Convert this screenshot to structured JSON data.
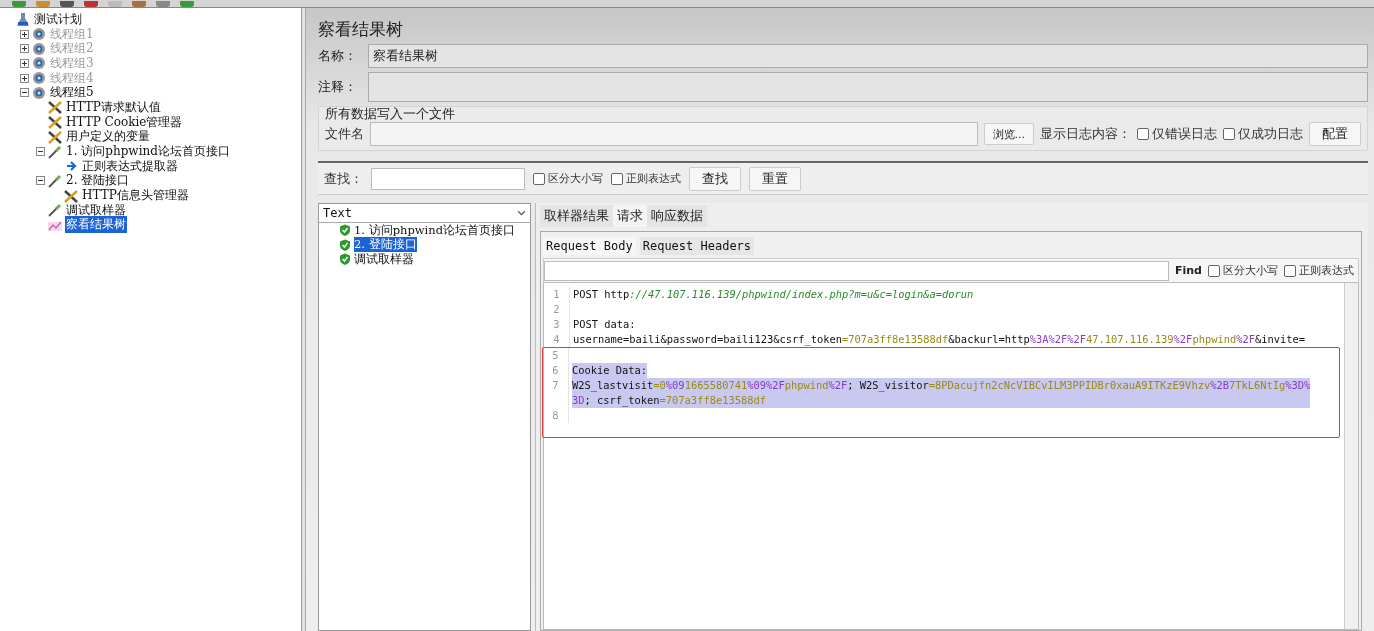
{
  "tree": [
    {
      "label": "测试计划",
      "kind": "plan",
      "selected": false,
      "disabled": false,
      "children": [
        {
          "label": "线程组1",
          "kind": "thread-group",
          "selected": false,
          "disabled": true,
          "expanded": false
        },
        {
          "label": "线程组2",
          "kind": "thread-group",
          "selected": false,
          "disabled": true,
          "expanded": false
        },
        {
          "label": "线程组3",
          "kind": "thread-group",
          "selected": false,
          "disabled": true,
          "expanded": false
        },
        {
          "label": "线程组4",
          "kind": "thread-group",
          "selected": false,
          "disabled": true,
          "expanded": false
        },
        {
          "label": "线程组5",
          "kind": "thread-group",
          "selected": false,
          "disabled": false,
          "expanded": true,
          "children": [
            {
              "label": "HTTP请求默认值",
              "kind": "config",
              "selected": false,
              "disabled": false
            },
            {
              "label": "HTTP Cookie管理器",
              "kind": "config",
              "selected": false,
              "disabled": false
            },
            {
              "label": "用户定义的变量",
              "kind": "config",
              "selected": false,
              "disabled": false
            },
            {
              "label": "1. 访问phpwind论坛首页接口",
              "kind": "sampler",
              "selected": false,
              "disabled": false,
              "expanded": true,
              "children": [
                {
                  "label": "正则表达式提取器",
                  "kind": "extractor",
                  "selected": false,
                  "disabled": false
                }
              ]
            },
            {
              "label": "2. 登陆接口",
              "kind": "sampler",
              "selected": false,
              "disabled": false,
              "expanded": true,
              "children": [
                {
                  "label": "HTTP信息头管理器",
                  "kind": "config",
                  "selected": false,
                  "disabled": false
                }
              ]
            },
            {
              "label": "调试取样器",
              "kind": "sampler",
              "selected": false,
              "disabled": false
            },
            {
              "label": "察看结果树",
              "kind": "listener",
              "selected": true,
              "disabled": false
            }
          ]
        }
      ]
    }
  ],
  "panel": {
    "title": "察看结果树",
    "name_label": "名称：",
    "name_value": "察看结果树",
    "comment_label": "注释：",
    "file_group": {
      "legend": "所有数据写入一个文件",
      "file_label": "文件名",
      "browse_button": "浏览...",
      "log_label": "显示日志内容：",
      "checkboxes": [
        {
          "label": "仅错误日志",
          "checked": false
        },
        {
          "label": "仅成功日志",
          "checked": false
        }
      ],
      "config_button": "配置"
    },
    "search": {
      "label": "查找：",
      "checkboxes": [
        {
          "label": "区分大小写",
          "checked": false
        },
        {
          "label": "正则表达式",
          "checked": false
        }
      ],
      "buttons": [
        "查找",
        "重置"
      ]
    },
    "results": {
      "renderer": "Text",
      "items": [
        {
          "label": "1. 访问phpwind论坛首页接口",
          "selected": false
        },
        {
          "label": "2. 登陆接口",
          "selected": true
        },
        {
          "label": "调试取样器",
          "selected": false
        }
      ]
    },
    "tabs": [
      {
        "label": "取样器结果",
        "selected": false
      },
      {
        "label": "请求",
        "selected": true
      },
      {
        "label": "响应数据",
        "selected": false
      }
    ],
    "subtabs": [
      {
        "label": "Request Body",
        "selected": true
      },
      {
        "label": "Request Headers",
        "selected": false
      }
    ],
    "find": {
      "label": "Find",
      "checkboxes": [
        {
          "label": "区分大小写",
          "checked": false
        },
        {
          "label": "正则表达式",
          "checked": false
        }
      ]
    },
    "code": [
      {
        "number": "1",
        "framed": false,
        "highlighted": false,
        "rows": [
          [
            {
              "text": "POST http",
              "kind": "plain"
            },
            {
              "text": "://47.107.116.139/phpwind/index.php?m=u&c=login&a=dorun",
              "kind": "url"
            }
          ]
        ]
      },
      {
        "number": "2",
        "framed": false,
        "highlighted": false,
        "rows": [
          []
        ]
      },
      {
        "number": "3",
        "framed": false,
        "highlighted": false,
        "rows": [
          [
            {
              "text": "POST data:",
              "kind": "plain"
            }
          ]
        ]
      },
      {
        "number": "4",
        "framed": false,
        "highlighted": false,
        "rows": [
          [
            {
              "text": "username=baili&password=baili123&csrf_token",
              "kind": "plain"
            },
            {
              "text": "=707a3ff8e13588df",
              "kind": "value"
            },
            {
              "text": "&backurl=http",
              "kind": "plain"
            },
            {
              "text": "%3A%2F%2F",
              "kind": "escape"
            },
            {
              "text": "47.107.116.139",
              "kind": "value"
            },
            {
              "text": "%2F",
              "kind": "escape"
            },
            {
              "text": "phpwind",
              "kind": "value"
            },
            {
              "text": "%2F",
              "kind": "escape"
            },
            {
              "text": "&invite=",
              "kind": "plain"
            }
          ]
        ]
      },
      {
        "number": "5",
        "framed": true,
        "highlighted": false,
        "rows": [
          []
        ]
      },
      {
        "number": "6",
        "framed": true,
        "highlighted": true,
        "rows": [
          [
            {
              "text": "Cookie Data:",
              "kind": "plain"
            }
          ]
        ]
      },
      {
        "number": "7",
        "framed": true,
        "highlighted": true,
        "rows": [
          [
            {
              "text": "W2S_lastvisit",
              "kind": "plain"
            },
            {
              "text": "=0",
              "kind": "value"
            },
            {
              "text": "%09",
              "kind": "escape"
            },
            {
              "text": "1665580741",
              "kind": "value"
            },
            {
              "text": "%09%2F",
              "kind": "escape"
            },
            {
              "text": "phpwind",
              "kind": "value"
            },
            {
              "text": "%2F",
              "kind": "escape"
            },
            {
              "text": "; W2S_visitor",
              "kind": "plain"
            },
            {
              "text": "=8PDacujfn2cNcVIBCvILM3PPIDBr0xauA9ITKzE9Vhzv",
              "kind": "value"
            },
            {
              "text": "%2B",
              "kind": "escape"
            },
            {
              "text": "7TkL6NtIg",
              "kind": "value"
            },
            {
              "text": "%3D%",
              "kind": "escape"
            }
          ],
          [
            {
              "text": "3D",
              "kind": "escape"
            },
            {
              "text": "; csrf_token",
              "kind": "plain"
            },
            {
              "text": "=707a3ff8e13588df",
              "kind": "value"
            }
          ]
        ]
      },
      {
        "number": "8",
        "framed": true,
        "highlighted": false,
        "rows": [
          []
        ]
      }
    ]
  }
}
